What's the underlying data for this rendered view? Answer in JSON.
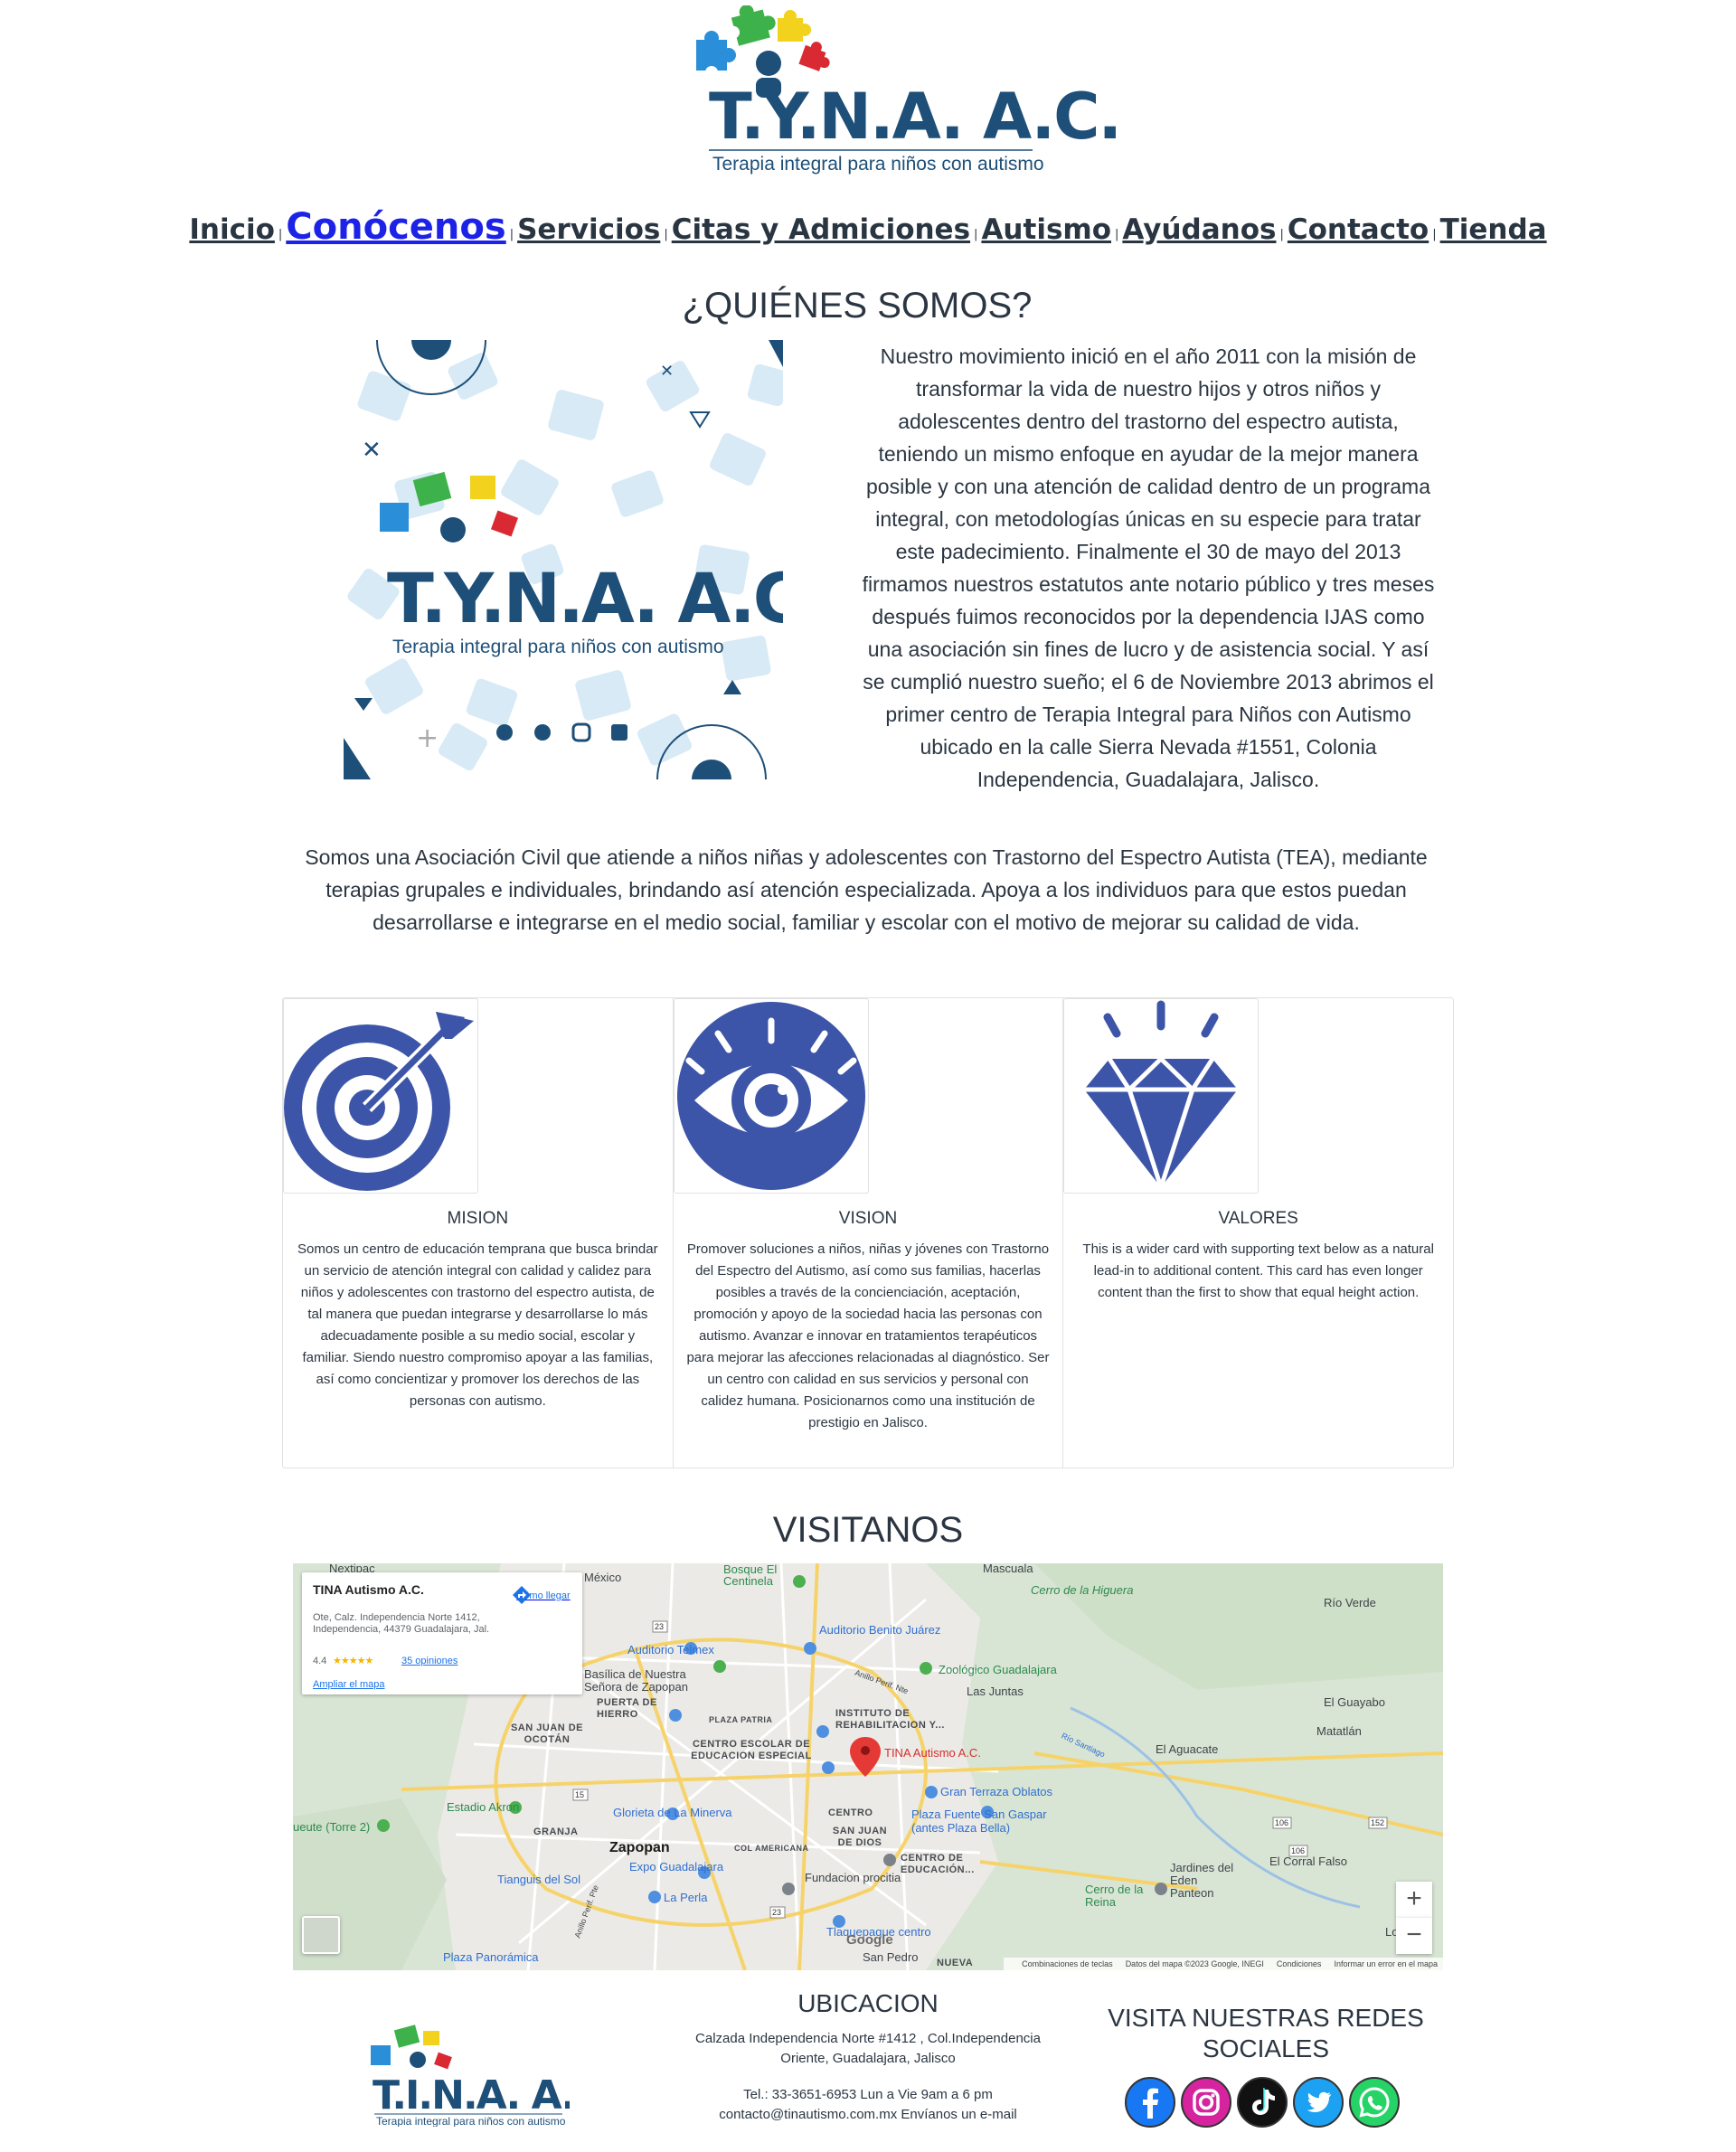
{
  "brand": {
    "logo_text": "T.Y.N.A. A.C.",
    "tagline": "Terapia integral para niños con autismo",
    "footer_logo_text": "T.I.N.A. A.C."
  },
  "nav": {
    "items": [
      "Inicio",
      "Conócenos",
      "Servicios",
      "Citas y Admiciones",
      "Autismo",
      "Ayúdanos",
      "Contacto",
      "Tienda"
    ],
    "active": "Conócenos",
    "separator": "|"
  },
  "about": {
    "title": "¿QUIÉNES SOMOS?",
    "paragraph_1": "Nuestro movimiento inició en el año 2011 con la misión de transformar la vida de nuestro hijos y otros niños y adolescentes dentro del trastorno del espectro autista, teniendo un mismo enfoque en ayudar de la mejor manera posible y con una atención de calidad dentro de un programa integral, con metodologías únicas en su especie para tratar este padecimiento. Finalmente el 30 de mayo del 2013 firmamos nuestros estatutos ante notario público y tres meses después fuimos reconocidos por la dependencia IJAS como una asociación sin fines de lucro y de asistencia social. Y así se cumplió nuestro sueño; el 6 de Noviembre 2013 abrimos el primer centro de Terapia Integral para Niños con Autismo ubicado en la calle Sierra Nevada #1551, Colonia Independencia, Guadalajara, Jalisco.",
    "paragraph_2": "Somos una Asociación Civil que atiende a niños niñas y adolescentes con Trastorno del Espectro Autista (TEA), mediante terapias grupales e individuales, brindando así atención especializada. Apoya a los individuos para que estos puedan desarrollarse e integrarse en el medio social, familiar y escolar con el motivo de mejorar su calidad de vida."
  },
  "cards": [
    {
      "title": "MISION",
      "icon": "target-icon",
      "text": "Somos un centro de educación temprana que busca brindar un servicio de atención integral con calidad y calidez para niños y adolescentes con trastorno del espectro autista, de tal manera que puedan integrarse y desarrollarse lo más adecuadamente posible a su medio social, escolar y familiar. Siendo nuestro compromiso apoyar a las familias, así como concientizar y promover los derechos de las personas con autismo."
    },
    {
      "title": "VISION",
      "icon": "eye-icon",
      "text": "Promover soluciones a niños, niñas y jóvenes con Trastorno del Espectro del Autismo, así como sus familias, hacerlas posibles a través de la concienciación, aceptación, promoción y apoyo de la sociedad hacia las personas con autismo. Avanzar e innovar en tratamientos terapéuticos para mejorar las afecciones relacionadas al diagnóstico. Ser un centro con calidad en sus servicios y personal con calidez humana. Posicionarnos como una institución de prestigio en Jalisco."
    },
    {
      "title": "VALORES",
      "icon": "diamond-icon",
      "text": "This is a wider card with supporting text below as a natural lead-in to additional content. This card has even longer content than the first to show that equal height action."
    }
  ],
  "map": {
    "title": "VISITANOS",
    "place_name": "TINA Autismo A.C.",
    "address": "Ote, Calz. Independencia Norte 1412, Independencia, 44379 Guadalajara, Jal.",
    "rating": "4.4",
    "stars": "★★★★★",
    "reviews": "35 opiniones",
    "directions_label": "Cómo llegar",
    "enlarge_label": "Ampliar el mapa",
    "marker_label": "TINA Autismo A.C.",
    "zoom_in": "+",
    "zoom_out": "−",
    "google": "Google",
    "footer": [
      "Combinaciones de teclas",
      "Datos del mapa ©2023 Google, INEGI",
      "Condiciones",
      "Informar un error en el mapa"
    ],
    "places": [
      {
        "label": "Nextipac",
        "style": "grey"
      },
      {
        "label": "México",
        "style": "grey"
      },
      {
        "label": "Bosque El Centinela",
        "style": "green"
      },
      {
        "label": "Mascuala",
        "style": "grey"
      },
      {
        "label": "Cerro de la Higuera",
        "style": "green"
      },
      {
        "label": "Río Verde",
        "style": "grey"
      },
      {
        "label": "Auditorio Benito Juárez",
        "style": "blue"
      },
      {
        "label": "Auditorio Telmex",
        "style": "blue"
      },
      {
        "label": "Zoológico Guadalajara",
        "style": "green"
      },
      {
        "label": "Las Juntas",
        "style": "grey"
      },
      {
        "label": "Basílica de Nuestra Señora de Zapopan",
        "style": "grey"
      },
      {
        "label": "PUERTA DE HIERRO",
        "style": "caps"
      },
      {
        "label": "PLAZA PATRIA",
        "style": "caps"
      },
      {
        "label": "INSTITUTO DE REHABILITACION Y...",
        "style": "caps"
      },
      {
        "label": "El Guayabo",
        "style": "grey"
      },
      {
        "label": "Matatlán",
        "style": "grey"
      },
      {
        "label": "SAN JUAN DE OCOTÁN",
        "style": "caps"
      },
      {
        "label": "CENTRO ESCOLAR DE EDUCACION ESPECIAL",
        "style": "caps"
      },
      {
        "label": "El Aguacate",
        "style": "grey"
      },
      {
        "label": "Gran Terraza Oblatos",
        "style": "blue"
      },
      {
        "label": "Estadio Akron",
        "style": "green"
      },
      {
        "label": "Glorieta de La Minerva",
        "style": "blue"
      },
      {
        "label": "CENTRO",
        "style": "caps"
      },
      {
        "label": "Plaza Fuente San Gaspar (antes Plaza Bella)",
        "style": "blue"
      },
      {
        "label": "ueute (Torre 2)",
        "style": "green"
      },
      {
        "label": "GRANJA",
        "style": "caps"
      },
      {
        "label": "SAN JUAN DE DIOS",
        "style": "caps"
      },
      {
        "label": "Zapopan",
        "style": "dark"
      },
      {
        "label": "COL AMERICANA",
        "style": "caps"
      },
      {
        "label": "CENTRO DE EDUCACIÓN...",
        "style": "caps"
      },
      {
        "label": "Expo Guadalajara",
        "style": "blue"
      },
      {
        "label": "Jardines del Eden Panteon",
        "style": "grey"
      },
      {
        "label": "El Corral Falso",
        "style": "grey"
      },
      {
        "label": "Tianguis del Sol",
        "style": "blue"
      },
      {
        "label": "Fundacion procitia",
        "style": "grey"
      },
      {
        "label": "Cerro de la Reina",
        "style": "green"
      },
      {
        "label": "La Perla",
        "style": "blue"
      },
      {
        "label": "Los Aren",
        "style": "grey"
      },
      {
        "label": "Tlaquepaque centro",
        "style": "blue"
      },
      {
        "label": "Plaza Panorámica",
        "style": "blue"
      },
      {
        "label": "San Pedro",
        "style": "grey"
      },
      {
        "label": "NUEVA",
        "style": "caps"
      },
      {
        "label": "Anillo Perif. Nte",
        "style": "grey"
      },
      {
        "label": "Anillo Perif. Pte",
        "style": "grey"
      },
      {
        "label": "Río Santiago",
        "style": "blue"
      }
    ],
    "roads": [
      "23",
      "15",
      "23",
      "106",
      "152",
      "106"
    ]
  },
  "footer": {
    "location_title": "UBICACION",
    "address_line_1": "Calzada Independencia Norte #1412 , Col.Independencia",
    "address_line_2": "Oriente, Guadalajara, Jalisco",
    "phone_line": "Tel.: 33-3651-6953 Lun a Vie 9am a 6 pm",
    "email_line": "contacto@tinautismo.com.mx Envíanos un e-mail",
    "social_title": "VISITA NUESTRAS REDES SOCIALES",
    "social": [
      "facebook-icon",
      "instagram-icon",
      "tiktok-icon",
      "twitter-icon",
      "whatsapp-icon"
    ]
  },
  "colors": {
    "brand_blue": "#1e4f78",
    "icon_blue": "#3d55a8",
    "link_active": "#1d23e6",
    "puzzle_blue": "#2a8fd8",
    "puzzle_green": "#3db24a",
    "puzzle_yellow": "#f2d21c",
    "puzzle_red": "#d92a33"
  }
}
